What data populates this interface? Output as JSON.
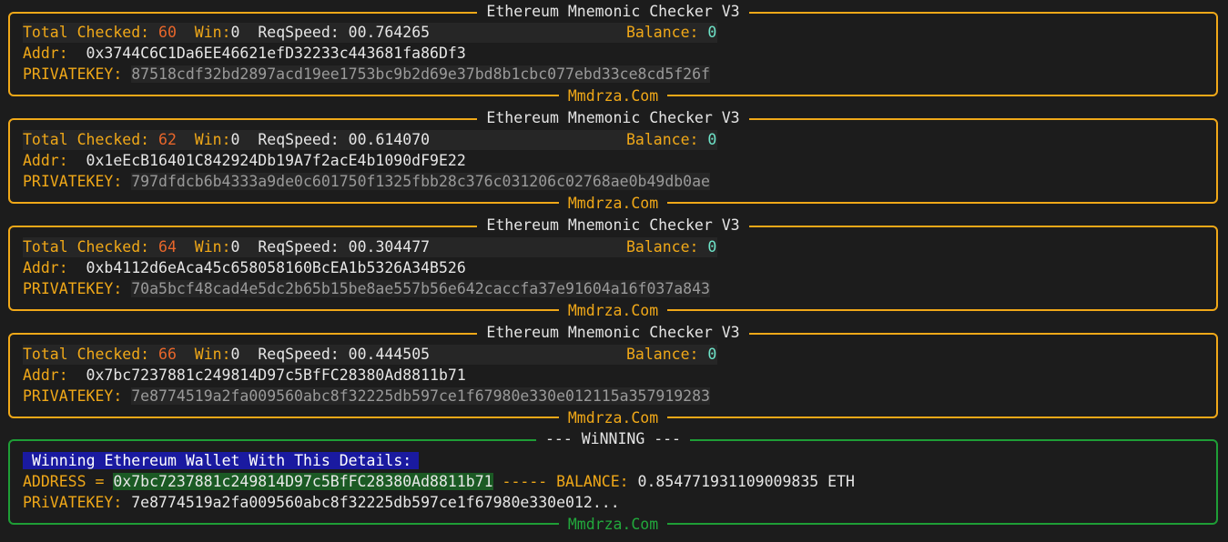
{
  "checker_panels": [
    {
      "title": "Ethereum Mnemonic Checker V3",
      "total_label": "Total Checked:",
      "total": "60",
      "win_label": "Win:",
      "win": "0",
      "speed_label": "ReqSpeed:",
      "speed": "00.764265",
      "balance_label": "Balance:",
      "balance": "0",
      "addr_label": "Addr:",
      "addr": "0x3744C6C1Da6EE46621efD32233c443681fa86Df3",
      "key_label": "PRIVATEKEY:",
      "key": "87518cdf32bd2897acd19ee1753bc9b2d69e37bd8b1cbc077ebd33ce8cd5f26f",
      "footer": "Mmdrza.Com"
    },
    {
      "title": "Ethereum Mnemonic Checker V3",
      "total_label": "Total Checked:",
      "total": "62",
      "win_label": "Win:",
      "win": "0",
      "speed_label": "ReqSpeed:",
      "speed": "00.614070",
      "balance_label": "Balance:",
      "balance": "0",
      "addr_label": "Addr:",
      "addr": "0x1eEcB16401C842924Db19A7f2acE4b1090dF9E22",
      "key_label": "PRIVATEKEY:",
      "key": "797dfdcb6b4333a9de0c601750f1325fbb28c376c031206c02768ae0b49db0ae",
      "footer": "Mmdrza.Com"
    },
    {
      "title": "Ethereum Mnemonic Checker V3",
      "total_label": "Total Checked:",
      "total": "64",
      "win_label": "Win:",
      "win": "0",
      "speed_label": "ReqSpeed:",
      "speed": "00.304477",
      "balance_label": "Balance:",
      "balance": "0",
      "addr_label": "Addr:",
      "addr": "0xb4112d6eAca45c658058160BcEA1b5326A34B526",
      "key_label": "PRIVATEKEY:",
      "key": "70a5bcf48cad4e5dc2b65b15be8ae557b56e642caccfa37e91604a16f037a843",
      "footer": "Mmdrza.Com"
    },
    {
      "title": "Ethereum Mnemonic Checker V3",
      "total_label": "Total Checked:",
      "total": "66",
      "win_label": "Win:",
      "win": "0",
      "speed_label": "ReqSpeed:",
      "speed": "00.444505",
      "balance_label": "Balance:",
      "balance": "0",
      "addr_label": "Addr:",
      "addr": "0x7bc7237881c249814D97c5BfFC28380Ad8811b71",
      "key_label": "PRIVATEKEY:",
      "key": "7e8774519a2fa009560abc8f32225db597ce1f67980e330e012115a357919283",
      "footer": "Mmdrza.Com"
    }
  ],
  "winning_panel": {
    "title": "--- WiNNING ---",
    "heading": "Winning Ethereum Wallet With This Details:",
    "address_label": "ADDRESS =",
    "address": "0x7bc7237881c249814D97c5BfFC28380Ad8811b71",
    "separator": "-----",
    "balance_label": "BALANCE:",
    "balance": "0.854771931109009835 ETH",
    "key_label": "PRiVATEKEY:",
    "key": "7e8774519a2fa009560abc8f32225db597ce1f67980e330e012...",
    "footer": "Mmdrza.Com"
  },
  "colors": {
    "background": "#1c1c1c",
    "panel_border": "#f0a818",
    "win_border": "#1e9e36",
    "label": "#f0a818",
    "count": "#e8662a",
    "balance_value": "#6ee3c8",
    "key_text": "#9a9a9a"
  }
}
